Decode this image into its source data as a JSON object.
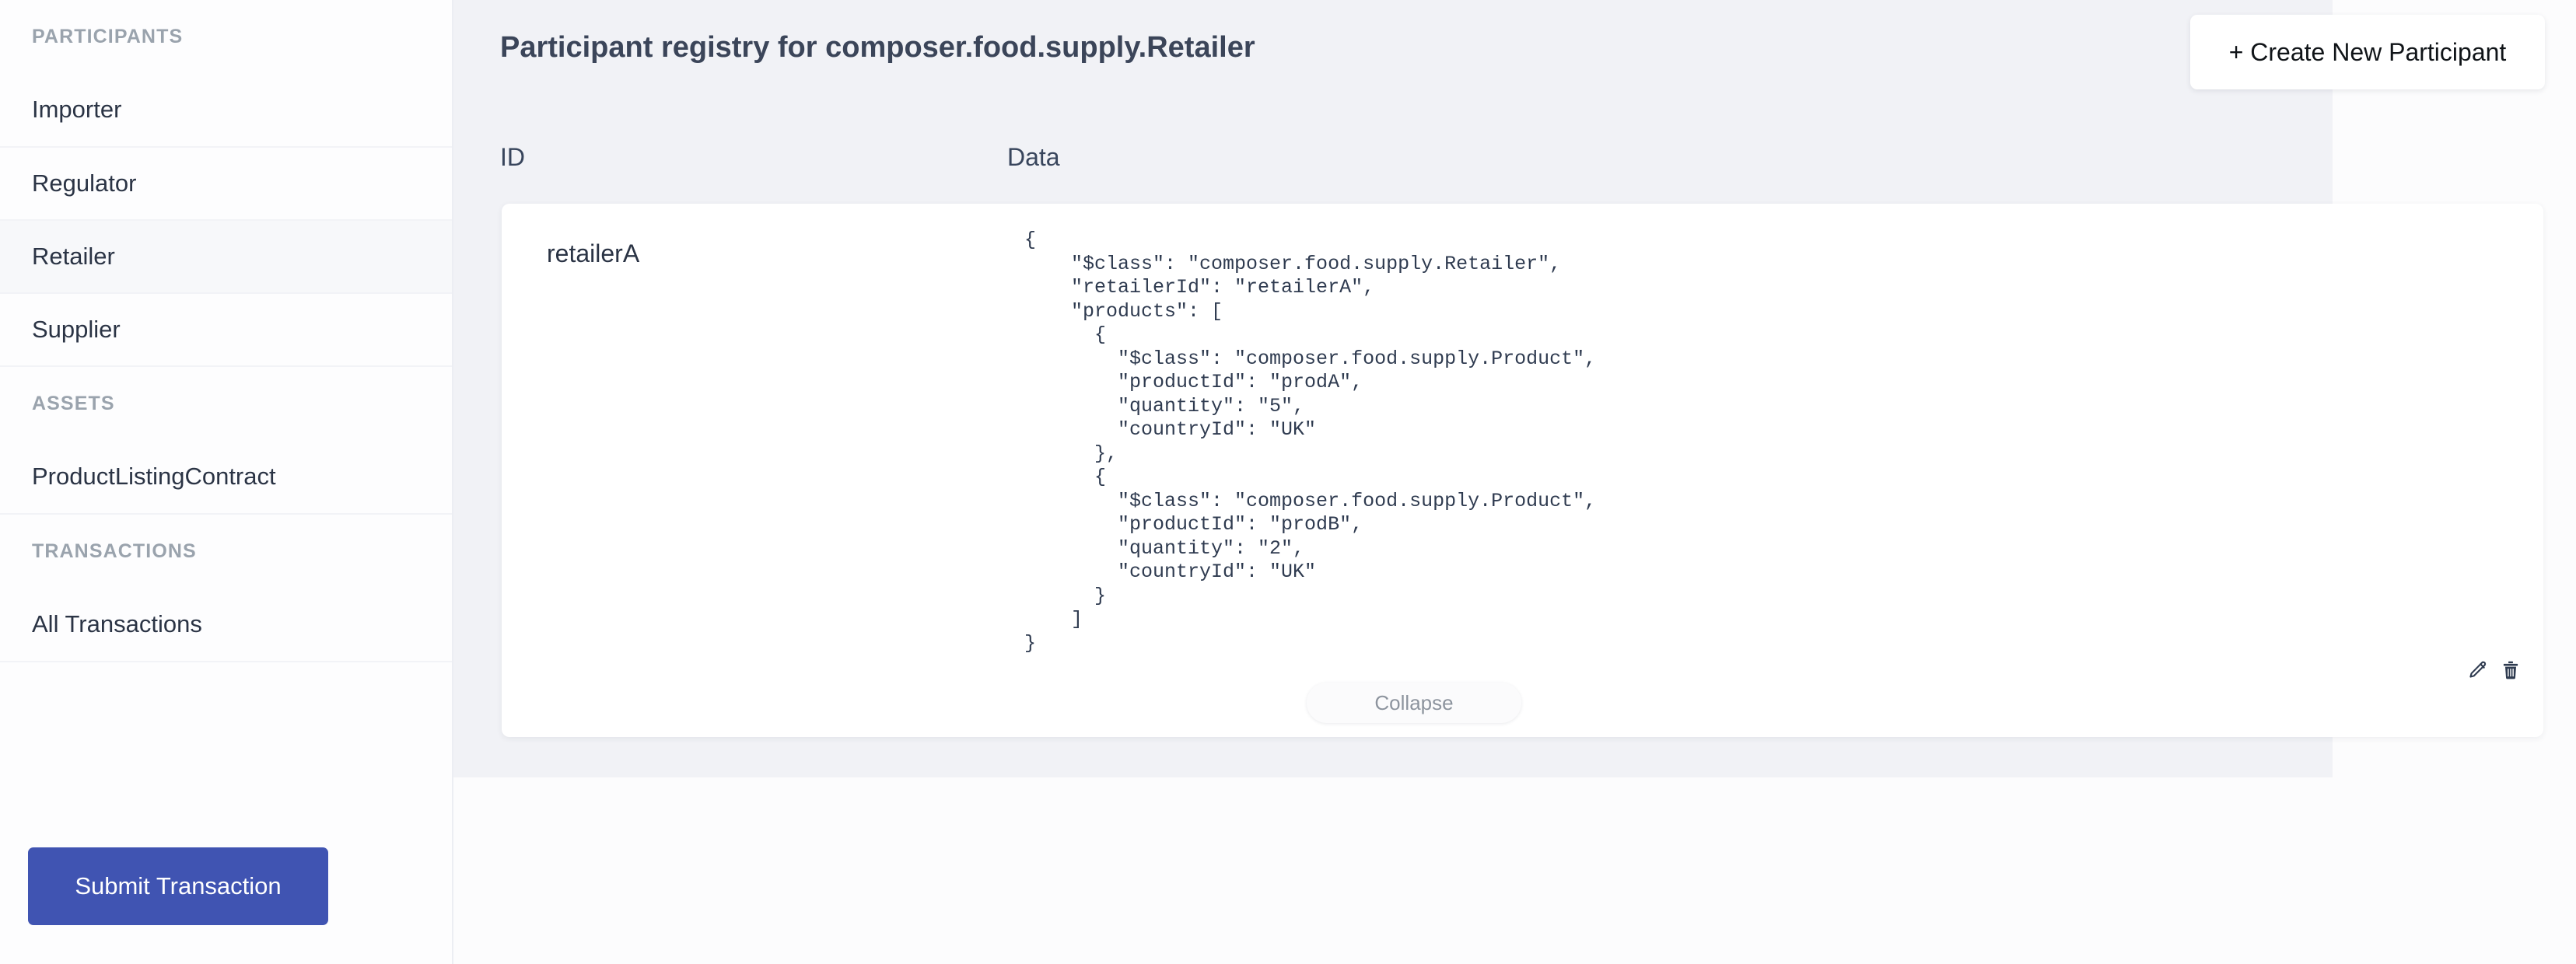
{
  "sidebar": {
    "groups": [
      {
        "label": "PARTICIPANTS",
        "items": [
          {
            "label": "Importer",
            "active": false
          },
          {
            "label": "Regulator",
            "active": false
          },
          {
            "label": "Retailer",
            "active": true
          },
          {
            "label": "Supplier",
            "active": false
          }
        ]
      },
      {
        "label": "ASSETS",
        "items": [
          {
            "label": "ProductListingContract",
            "active": false
          }
        ]
      },
      {
        "label": "TRANSACTIONS",
        "items": [
          {
            "label": "All Transactions",
            "active": false
          }
        ]
      }
    ],
    "submit_button_label": "Submit Transaction"
  },
  "header": {
    "title": "Participant registry for composer.food.supply.Retailer",
    "create_button_label": "+ Create New Participant"
  },
  "table": {
    "columns": [
      "ID",
      "Data"
    ],
    "rows": [
      {
        "id": "retailerA",
        "json": "{\n    \"$class\": \"composer.food.supply.Retailer\",\n    \"retailerId\": \"retailerA\",\n    \"products\": [\n      {\n        \"$class\": \"composer.food.supply.Product\",\n        \"productId\": \"prodA\",\n        \"quantity\": \"5\",\n        \"countryId\": \"UK\"\n      },\n      {\n        \"$class\": \"composer.food.supply.Product\",\n        \"productId\": \"prodB\",\n        \"quantity\": \"2\",\n        \"countryId\": \"UK\"\n      }\n    ]\n}",
        "actions": [
          "edit-icon",
          "delete-icon"
        ],
        "collapse_label": "Collapse"
      }
    ]
  },
  "colors": {
    "accent": "#4054b2",
    "page_background": "#f1f2f6",
    "sidebar_background": "#fdfdfe",
    "card_background": "#ffffff",
    "text_primary": "#2b3445",
    "text_muted": "#9aa3ad",
    "active_row": "#f7f8fa"
  }
}
